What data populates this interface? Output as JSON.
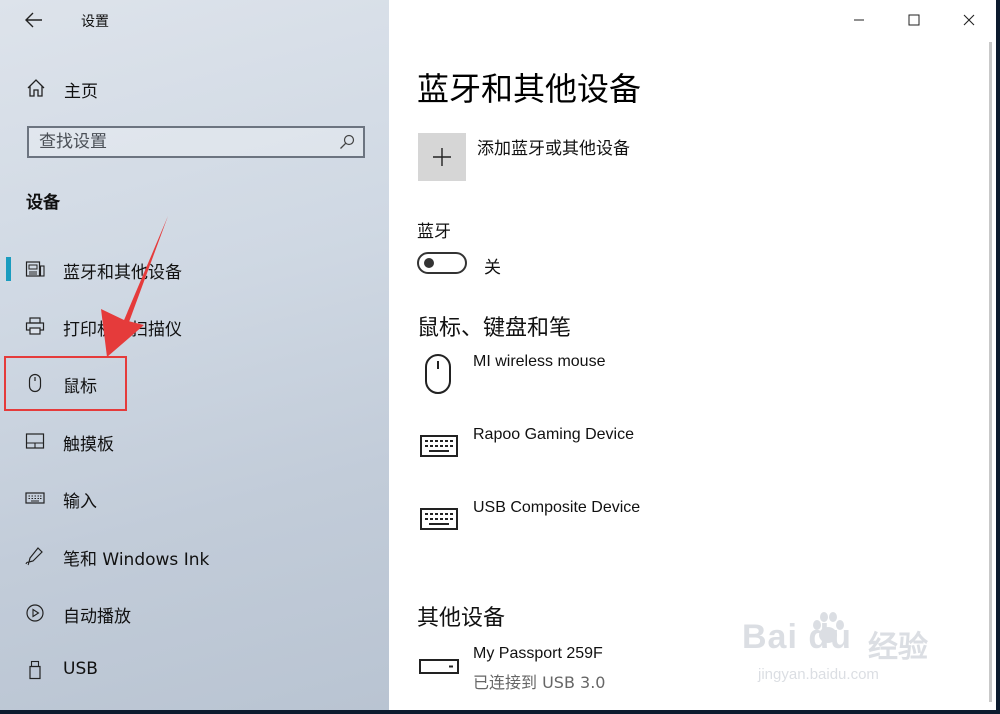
{
  "window": {
    "title": "设置",
    "controls": {
      "minimize": "minimize",
      "maximize": "maximize",
      "close": "close"
    }
  },
  "sidebar": {
    "home_label": "主页",
    "search": {
      "placeholder": "查找设置",
      "value": ""
    },
    "section_title": "设备",
    "items": [
      {
        "label": "蓝牙和其他设备",
        "icon": "bluetooth-devices-icon",
        "selected": true
      },
      {
        "label": "打印机和扫描仪",
        "icon": "printer-icon",
        "selected": false
      },
      {
        "label": "鼠标",
        "icon": "mouse-icon",
        "selected": false,
        "highlighted": true
      },
      {
        "label": "触摸板",
        "icon": "touchpad-icon",
        "selected": false
      },
      {
        "label": "输入",
        "icon": "keyboard-icon",
        "selected": false
      },
      {
        "label": "笔和 Windows Ink",
        "icon": "pen-icon",
        "selected": false
      },
      {
        "label": "自动播放",
        "icon": "autoplay-icon",
        "selected": false
      },
      {
        "label": "USB",
        "icon": "usb-icon",
        "selected": false
      }
    ]
  },
  "main": {
    "page_title": "蓝牙和其他设备",
    "add_device_label": "添加蓝牙或其他设备",
    "bluetooth": {
      "label": "蓝牙",
      "state_label": "关",
      "on": false
    },
    "groups": [
      {
        "title": "鼠标、键盘和笔",
        "devices": [
          {
            "name": "MI wireless mouse",
            "icon": "mouse-icon",
            "status": ""
          },
          {
            "name": "Rapoo Gaming Device",
            "icon": "keyboard-icon",
            "status": ""
          },
          {
            "name": "USB Composite Device",
            "icon": "keyboard-icon",
            "status": ""
          }
        ]
      },
      {
        "title": "其他设备",
        "devices": [
          {
            "name": "My Passport 259F",
            "icon": "drive-icon",
            "status": "已连接到 USB 3.0"
          }
        ]
      }
    ]
  },
  "watermark": {
    "brand": "Bai du",
    "label": "经验",
    "url": "jingyan.baidu.com"
  },
  "colors": {
    "accent": "#1a9cbf",
    "annotation": "#e53b3b"
  }
}
